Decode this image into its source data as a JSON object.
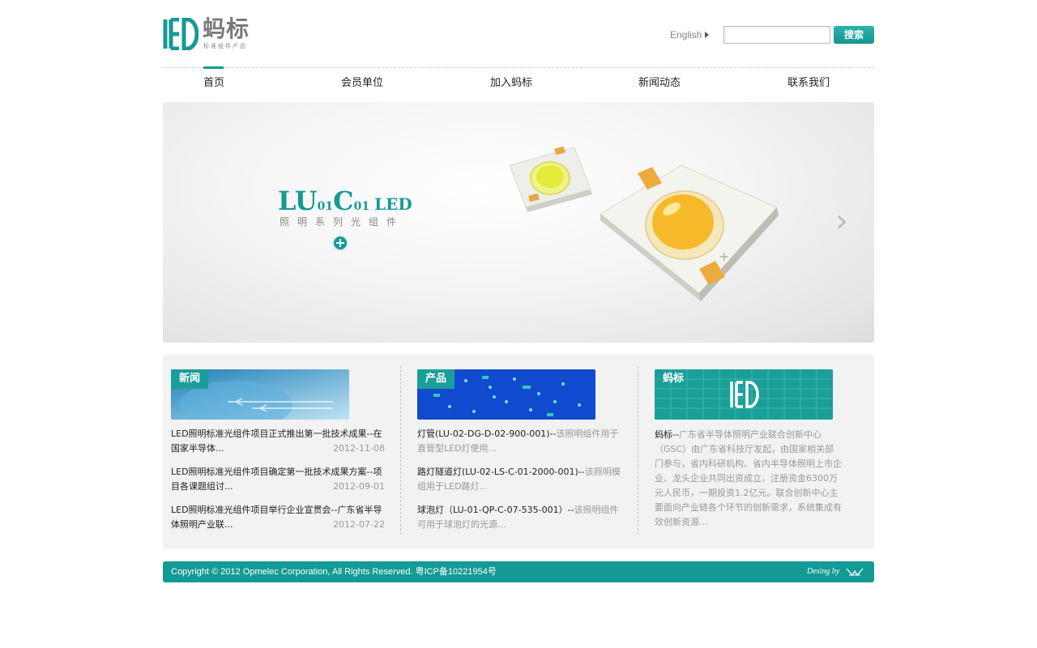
{
  "header": {
    "brand": "蚂标",
    "tagline": "标准组件产品",
    "language_link": "English",
    "search_button": "搜索",
    "search_value": ""
  },
  "nav": {
    "items": [
      "首页",
      "会员单位",
      "加入蚂标",
      "新闻动态",
      "联系我们"
    ],
    "active": "首页"
  },
  "banner": {
    "title_a": "LU",
    "title_b": "01",
    "title_c": "C",
    "title_d": "01",
    "title_e": "LED",
    "subtitle": "照明系列光组件"
  },
  "news": {
    "heading": "新闻",
    "items": [
      {
        "title": "LED照明标准光组件项目正式推出第一批技术成果--在国家半导体...",
        "date": "2012-11-08"
      },
      {
        "title": "LED照明标准光组件项目确定第一批技术成果方案--项目各课题组讨...",
        "date": "2012-09-01"
      },
      {
        "title": "LED照明标准光组件项目举行企业宣贯会--广东省半导体照明产业联...",
        "date": "2012-07-22"
      }
    ]
  },
  "products": {
    "heading": "产品",
    "items": [
      {
        "name": "灯管(LU-02-DG-D-02-900-001)--",
        "desc": "该照明组件用于直管型LED灯使用..."
      },
      {
        "name": "路灯隧道灯(LU-02-LS-C-01-2000-001)--",
        "desc": "该照明模组用于LED路灯..."
      },
      {
        "name": "球泡灯（LU-01-QP-C-07-535-001）--",
        "desc": "该照明组件可用于球泡灯的光源..."
      }
    ]
  },
  "about": {
    "heading": "蚂标",
    "lead": "蚂标--",
    "body": "广东省半导体照明产业联合创新中心（GSC）由广东省科技厅发起，由国家相关部门参与，省内科研机构、省内半导体照明上市企业、龙头企业共同出资成立，注册资金6300万元人民币，一期投资1.2亿元。联合创新中心主要面向产业链各个环节的创新需求，系统集成有效创新资源..."
  },
  "footer": {
    "copyright": "Copyright © 2012 Opmelec Corporation, All Rights Reserved. 粤ICP备10221954号",
    "design_credit": "Desing by"
  },
  "colors": {
    "accent": "#149a94",
    "panel": "#f2f2f2",
    "muted": "#999999"
  }
}
